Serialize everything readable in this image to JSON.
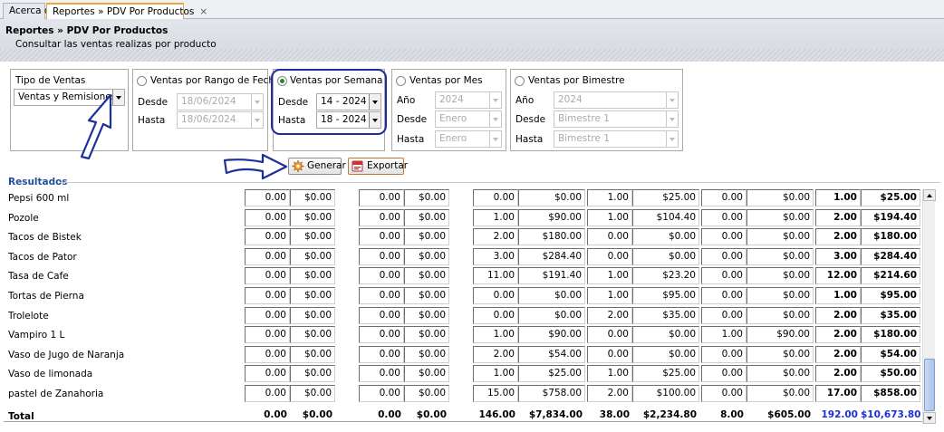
{
  "tabs": [
    {
      "label": "Acerca de"
    },
    {
      "label": "Reportes » PDV Por Productos",
      "close": "×"
    }
  ],
  "header": {
    "title": "Reportes » PDV Por Productos",
    "subtitle": "Consultar las ventas realizas por producto"
  },
  "tipo_ventas": {
    "label": "Tipo de Ventas",
    "value": "Ventas y Remisiones"
  },
  "rango_fechas": {
    "label": "Ventas por Rango de Fechas",
    "selected": false,
    "desde_label": "Desde",
    "desde_value": "18/06/2024",
    "hasta_label": "Hasta",
    "hasta_value": "18/06/2024"
  },
  "por_semana": {
    "label": "Ventas por Semana",
    "selected": true,
    "desde_label": "Desde",
    "desde_value": "14 - 2024",
    "hasta_label": "Hasta",
    "hasta_value": "18 - 2024"
  },
  "por_mes": {
    "label": "Ventas por Mes",
    "selected": false,
    "anio_label": "Año",
    "anio_value": "2024",
    "desde_label": "Desde",
    "desde_value": "Enero",
    "hasta_label": "Hasta",
    "hasta_value": "Enero"
  },
  "por_bimestre": {
    "label": "Ventas por Bimestre",
    "selected": false,
    "anio_label": "Año",
    "anio_value": "2024",
    "desde_label": "Desde",
    "desde_value": "Bimestre 1",
    "hasta_label": "Hasta",
    "hasta_value": "Bimestre 1"
  },
  "buttons": {
    "generar": "Generar",
    "exportar": "Exportar"
  },
  "results": {
    "title": "Resultados",
    "rows": [
      {
        "name": "Pepsi 600 ml",
        "values": [
          "0.00",
          "$0.00",
          "0.00",
          "$0.00",
          "0.00",
          "$0.00",
          "1.00",
          "$25.00",
          "0.00",
          "$0.00",
          "1.00",
          "$25.00"
        ]
      },
      {
        "name": "Pozole",
        "values": [
          "0.00",
          "$0.00",
          "0.00",
          "$0.00",
          "1.00",
          "$90.00",
          "1.00",
          "$104.40",
          "0.00",
          "$0.00",
          "2.00",
          "$194.40"
        ]
      },
      {
        "name": "Tacos de Bistek",
        "values": [
          "0.00",
          "$0.00",
          "0.00",
          "$0.00",
          "2.00",
          "$180.00",
          "0.00",
          "$0.00",
          "0.00",
          "$0.00",
          "2.00",
          "$180.00"
        ]
      },
      {
        "name": "Tacos de Pator",
        "values": [
          "0.00",
          "$0.00",
          "0.00",
          "$0.00",
          "3.00",
          "$284.40",
          "0.00",
          "$0.00",
          "0.00",
          "$0.00",
          "3.00",
          "$284.40"
        ]
      },
      {
        "name": "Tasa de Cafe",
        "values": [
          "0.00",
          "$0.00",
          "0.00",
          "$0.00",
          "11.00",
          "$191.40",
          "1.00",
          "$23.20",
          "0.00",
          "$0.00",
          "12.00",
          "$214.60"
        ]
      },
      {
        "name": "Tortas de Pierna",
        "values": [
          "0.00",
          "$0.00",
          "0.00",
          "$0.00",
          "0.00",
          "$0.00",
          "1.00",
          "$95.00",
          "0.00",
          "$0.00",
          "1.00",
          "$95.00"
        ]
      },
      {
        "name": "Trolelote",
        "values": [
          "0.00",
          "$0.00",
          "0.00",
          "$0.00",
          "0.00",
          "$0.00",
          "2.00",
          "$35.00",
          "0.00",
          "$0.00",
          "2.00",
          "$35.00"
        ]
      },
      {
        "name": "Vampiro 1 L",
        "values": [
          "0.00",
          "$0.00",
          "0.00",
          "$0.00",
          "1.00",
          "$90.00",
          "0.00",
          "$0.00",
          "1.00",
          "$90.00",
          "2.00",
          "$180.00"
        ]
      },
      {
        "name": "Vaso de Jugo de Naranja",
        "values": [
          "0.00",
          "$0.00",
          "0.00",
          "$0.00",
          "2.00",
          "$54.00",
          "0.00",
          "$0.00",
          "0.00",
          "$0.00",
          "2.00",
          "$54.00"
        ]
      },
      {
        "name": "Vaso de limonada",
        "values": [
          "0.00",
          "$0.00",
          "0.00",
          "$0.00",
          "1.00",
          "$25.00",
          "1.00",
          "$25.00",
          "0.00",
          "$0.00",
          "2.00",
          "$50.00"
        ]
      },
      {
        "name": "pastel de Zanahoria",
        "values": [
          "0.00",
          "$0.00",
          "0.00",
          "$0.00",
          "15.00",
          "$758.00",
          "2.00",
          "$100.00",
          "0.00",
          "$0.00",
          "17.00",
          "$858.00"
        ]
      }
    ],
    "total": {
      "name": "Total",
      "values": [
        "0.00",
        "$0.00",
        "0.00",
        "$0.00",
        "146.00",
        "$7,834.00",
        "38.00",
        "$2,234.80",
        "8.00",
        "$605.00",
        "192.00",
        "$10,673.80"
      ]
    }
  },
  "colors": {
    "accent": "#1d2f9a",
    "section_title": "#1f4e9a",
    "total_blue": "#1d2fd6"
  }
}
